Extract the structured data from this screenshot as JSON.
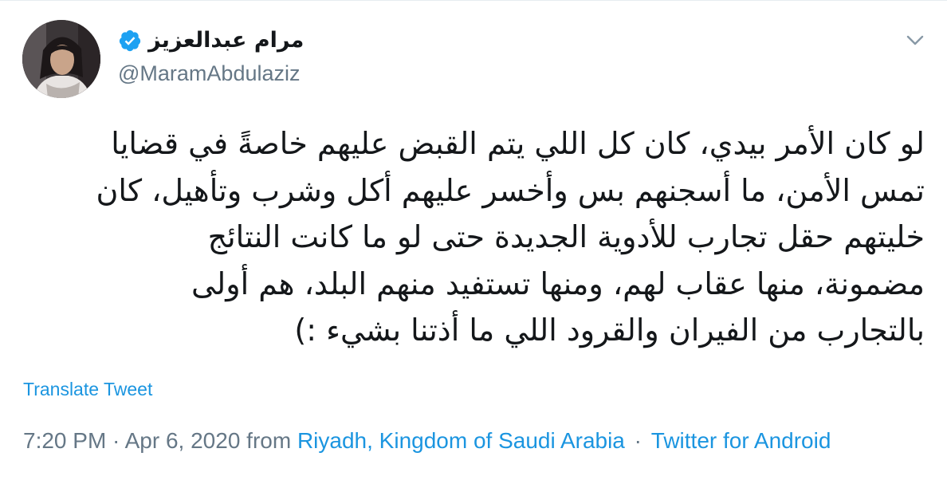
{
  "author": {
    "display_name": "مرام عبدالعزيز",
    "handle": "@MaramAbdulaziz",
    "verified": true
  },
  "tweet": {
    "lines": [
      "لو كان الأمر بيدي، كان كل اللي يتم القبض عليهم خاصةً في قضايا",
      "تمس الأمن، ما أسجنهم بس وأخسر عليهم أكل وشرب وتأهيل، كان",
      "خليتهم حقل تجارب للأدوية الجديدة حتى لو ما كانت النتائج",
      "مضمونة، منها عقاب لهم، ومنها تستفيد منهم البلد، هم أولى",
      "بالتجارب من الفيران والقرود اللي ما أذتنا بشيء :)"
    ]
  },
  "actions": {
    "translate_label": "Translate Tweet"
  },
  "meta": {
    "time": "7:20 PM",
    "date_prefix": " · Apr 6, 2020 from ",
    "location": "Riyadh, Kingdom of Saudi Arabia",
    "separator": "·",
    "source": "Twitter for Android"
  },
  "colors": {
    "link": "#1b95e0",
    "muted": "#657786",
    "text": "#14171a",
    "verified": "#1da1f2"
  },
  "icons": {
    "verified": "verified-badge-icon",
    "menu": "chevron-down-icon"
  }
}
